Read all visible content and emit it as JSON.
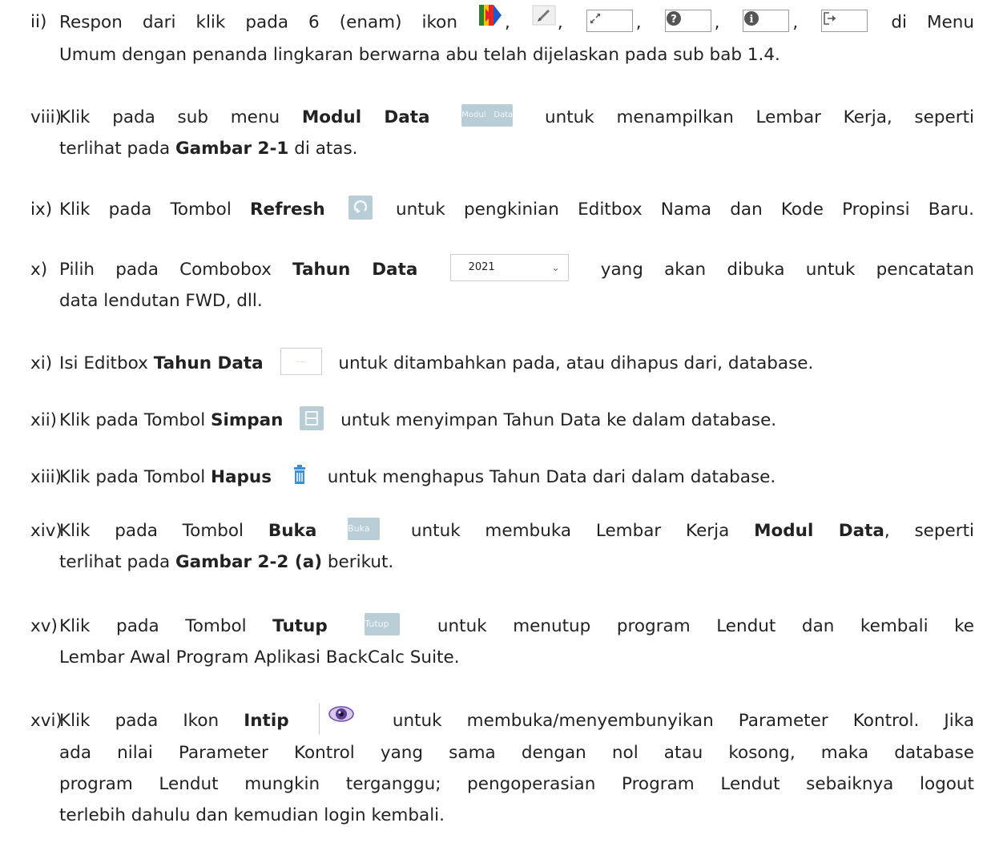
{
  "items": [
    {
      "num": "ii)",
      "l1_a": "Respon dari klik pada 6 (enam) ikon",
      "l1_b": "di Menu",
      "l2": "Umum  dengan penanda lingkaran berwarna abu telah dijelaskan pada sub bab 1.4."
    },
    {
      "num": "viii)",
      "pre": "Klik pada sub menu",
      "bold": "Modul Data",
      "btn": "Modul Data",
      "post": "untuk menampilkan Lembar Kerja, seperti",
      "l2_a": "terlihat pada",
      "l2_bold": "Gambar 2-1",
      "l2_b": "di atas."
    },
    {
      "num": "ix)",
      "pre": "Klik pada Tombol",
      "bold": "Refresh",
      "post": "untuk pengkinian Editbox Nama dan Kode Propinsi Baru."
    },
    {
      "num": "x)",
      "pre": "Pilih pada Combobox",
      "bold": "Tahun Data",
      "combo_value": "2021",
      "post": "yang akan dibuka untuk pencatatan",
      "l2": "data lendutan FWD, dll."
    },
    {
      "num": "xi)",
      "pre": "Isi Editbox",
      "bold": "Tahun Data",
      "edit_placeholder": "....",
      "post": "untuk ditambahkan pada, atau dihapus dari, database."
    },
    {
      "num": "xii)",
      "pre": "Klik pada Tombol",
      "bold": "Simpan",
      "post": "untuk menyimpan Tahun Data ke dalam database."
    },
    {
      "num": "xiii)",
      "pre": "Klik pada Tombol",
      "bold": "Hapus",
      "post": "untuk menghapus Tahun Data dari dalam database."
    },
    {
      "num": "xiv)",
      "pre": "Klik pada Tombol",
      "bold": "Buka",
      "btn": "Buka",
      "post": "untuk membuka Lembar Kerja",
      "bold2": "Modul Data",
      "post2": ", seperti",
      "l2_a": "terlihat pada",
      "l2_bold": "Gambar 2-2 (a)",
      "l2_b": "berikut."
    },
    {
      "num": "xv)",
      "pre": "Klik pada Tombol",
      "bold": "Tutup",
      "btn": "Tutup",
      "post": "untuk menutup program Lendut dan kembali ke",
      "l2": "Lembar Awal Program Aplikasi BackCalc Suite."
    },
    {
      "num": "xvi)",
      "pre": "Klik pada Ikon",
      "bold": "Intip",
      "post": "untuk membuka/menyembunyikan Parameter Kontrol.  Jika",
      "l2": "ada nilai Parameter Kontrol yang sama dengan nol atau kosong, maka database",
      "l3": "program Lendut mungkin terganggu;  pengoperasian Program Lendut sebaiknya logout",
      "l4": "terlebih dahulu dan kemudian login kembali."
    }
  ],
  "icons": {
    "color_icon": "color-palette-icon",
    "pencil": "pencil-icon",
    "expand": "expand-icon",
    "help": "help-icon",
    "info": "info-icon",
    "logout": "logout-icon",
    "refresh": "refresh-icon",
    "save": "save-icon",
    "trash": "trash-icon",
    "eye": "eye-icon"
  },
  "colors": {
    "button_bg": "#b8cdd6",
    "text": "#222222"
  }
}
